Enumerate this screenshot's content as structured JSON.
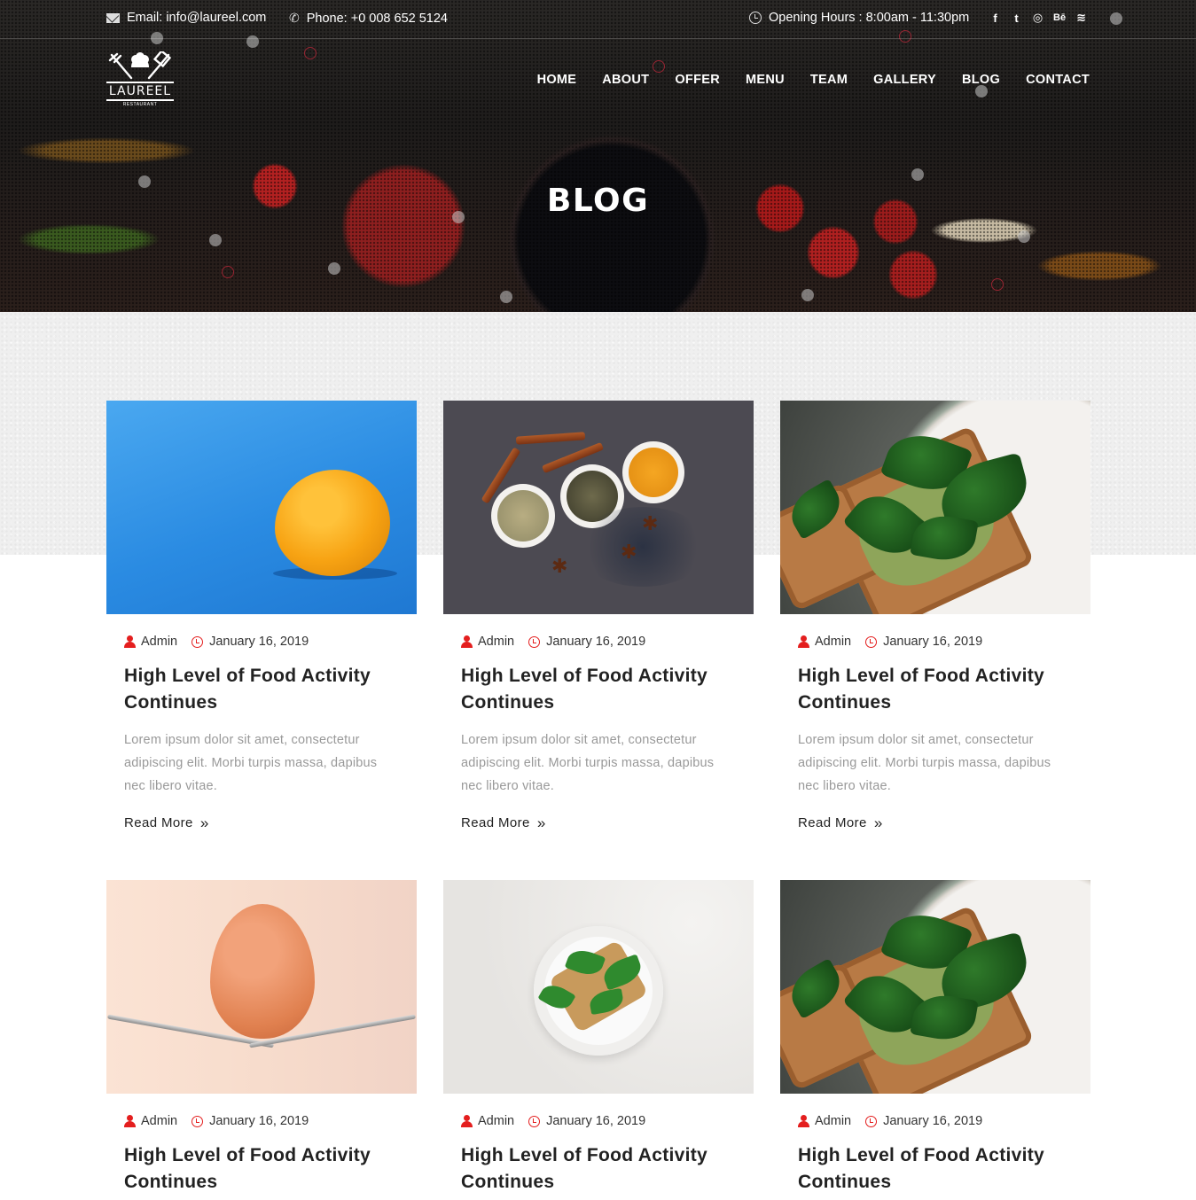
{
  "topbar": {
    "email": "Email: info@laureel.com",
    "phone": "Phone: +0 008 652 5124",
    "hours": "Opening Hours : 8:00am - 11:30pm",
    "social": [
      {
        "icon": "facebook-icon",
        "glyph": "f"
      },
      {
        "icon": "twitter-icon",
        "glyph": "t"
      },
      {
        "icon": "dribbble-icon",
        "glyph": "◎"
      },
      {
        "icon": "behance-icon",
        "glyph": "Bē"
      },
      {
        "icon": "rss-icon",
        "glyph": "≋"
      }
    ]
  },
  "logo": {
    "name": "LAUREEL",
    "tagline": "RESTAURANT"
  },
  "nav": [
    "HOME",
    "ABOUT",
    "OFFER",
    "MENU",
    "TEAM",
    "GALLERY",
    "BLOG",
    "CONTACT"
  ],
  "hero": {
    "title": "BLOG"
  },
  "posts": [
    {
      "author": "Admin",
      "date": "January 16, 2019",
      "title": "High Level of Food Activity Continues",
      "excerpt": "Lorem ipsum dolor sit amet, consectetur adipiscing elit. Morbi turpis massa, dapibus nec libero vitae.",
      "read_more": "Read More",
      "image": "lemon"
    },
    {
      "author": "Admin",
      "date": "January 16, 2019",
      "title": "High Level of Food Activity Continues",
      "excerpt": "Lorem ipsum dolor sit amet, consectetur adipiscing elit. Morbi turpis massa, dapibus nec libero vitae.",
      "read_more": "Read More",
      "image": "spices"
    },
    {
      "author": "Admin",
      "date": "January 16, 2019",
      "title": "High Level of Food Activity Continues",
      "excerpt": "Lorem ipsum dolor sit amet, consectetur adipiscing elit. Morbi turpis massa, dapibus nec libero vitae.",
      "read_more": "Read More",
      "image": "spinach-toast"
    },
    {
      "author": "Admin",
      "date": "January 16, 2019",
      "title": "High Level of Food Activity Continues",
      "image": "egg-on-forks"
    },
    {
      "author": "Admin",
      "date": "January 16, 2019",
      "title": "High Level of Food Activity Continues",
      "image": "toast-plate"
    },
    {
      "author": "Admin",
      "date": "January 16, 2019",
      "title": "High Level of Food Activity Continues",
      "image": "spinach-toast"
    }
  ],
  "colors": {
    "accent": "#e41e1e",
    "text": "#222222",
    "muted": "#999999"
  }
}
